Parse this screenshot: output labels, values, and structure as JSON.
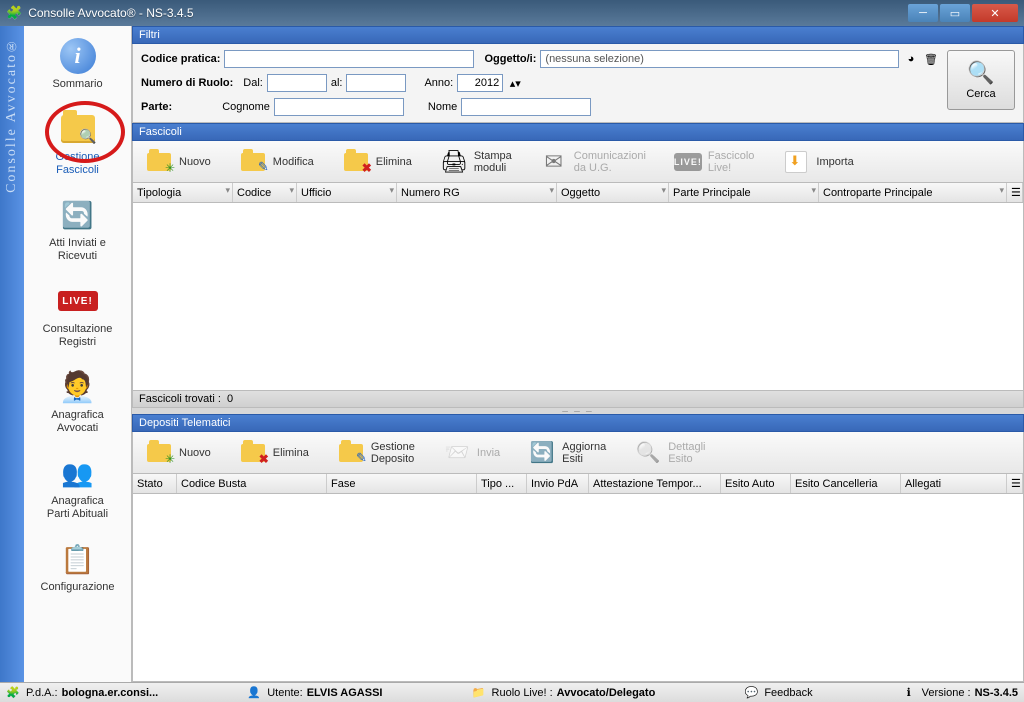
{
  "window": {
    "title": "Consolle Avvocato® - NS-3.4.5"
  },
  "vstrip_text": "Consolle Avvocato®",
  "sidenav": {
    "items": [
      {
        "label": "Sommario",
        "icon": "info"
      },
      {
        "label": "Gestione\nFascicoli",
        "icon": "folder-search",
        "active": true,
        "circled": true
      },
      {
        "label": "Atti Inviati e\nRicevuti",
        "icon": "arrows"
      },
      {
        "label": "Consultazione\nRegistri",
        "icon": "live"
      },
      {
        "label": "Anagrafica\nAvvocati",
        "icon": "lawyer"
      },
      {
        "label": "Anagrafica\nParti Abituali",
        "icon": "users"
      },
      {
        "label": "Configurazione",
        "icon": "sheet"
      }
    ]
  },
  "filters": {
    "header": "Filtri",
    "codice_label": "Codice pratica:",
    "codice_value": "",
    "oggetto_label": "Oggetto/i:",
    "oggetto_value": "(nessuna selezione)",
    "numero_label": "Numero di Ruolo:",
    "dal_label": "Dal:",
    "dal_value": "",
    "al_label": "al:",
    "al_value": "",
    "anno_label": "Anno:",
    "anno_value": "2012",
    "parte_label": "Parte:",
    "cognome_label": "Cognome",
    "cognome_value": "",
    "nome_label": "Nome",
    "nome_value": "",
    "search_label": "Cerca"
  },
  "fascicoli": {
    "header": "Fascicoli",
    "toolbar": [
      {
        "label": "Nuovo",
        "icon": "folder-new"
      },
      {
        "label": "Modifica",
        "icon": "folder-edit"
      },
      {
        "label": "Elimina",
        "icon": "folder-del"
      },
      {
        "label": "Stampa\nmoduli",
        "icon": "printer"
      },
      {
        "label": "Comunicazioni\nda U.G.",
        "icon": "mail",
        "disabled": true
      },
      {
        "label": "Fascicolo\nLive!",
        "icon": "live",
        "disabled": true
      },
      {
        "label": "Importa",
        "icon": "import"
      }
    ],
    "columns": [
      "Tipologia",
      "Codice",
      "Ufficio",
      "Numero RG",
      "Oggetto",
      "Parte Principale",
      "Controparte Principale"
    ],
    "found_label": "Fascicoli trovati :",
    "found_count": "0"
  },
  "depositi": {
    "header": "Depositi Telematici",
    "toolbar": [
      {
        "label": "Nuovo",
        "icon": "folder-new"
      },
      {
        "label": "Elimina",
        "icon": "folder-del"
      },
      {
        "label": "Gestione\nDeposito",
        "icon": "folder-edit"
      },
      {
        "label": "Invia",
        "icon": "send",
        "disabled": true
      },
      {
        "label": "Aggiorna\nEsiti",
        "icon": "refresh"
      },
      {
        "label": "Dettagli\nEsito",
        "icon": "details",
        "disabled": true
      }
    ],
    "columns": [
      "Stato",
      "Codice Busta",
      "Fase",
      "Tipo ...",
      "Invio PdA",
      "Attestazione Tempor...",
      "Esito Auto",
      "Esito Cancelleria",
      "Allegati"
    ]
  },
  "statusbar": {
    "pda_label": "P.d.A.:",
    "pda_value": "bologna.er.consi...",
    "utente_label": "Utente:",
    "utente_value": "ELVIS AGASSI",
    "ruolo_label": "Ruolo Live! :",
    "ruolo_value": "Avvocato/Delegato",
    "feedback": "Feedback",
    "versione_label": "Versione :",
    "versione_value": "NS-3.4.5"
  }
}
